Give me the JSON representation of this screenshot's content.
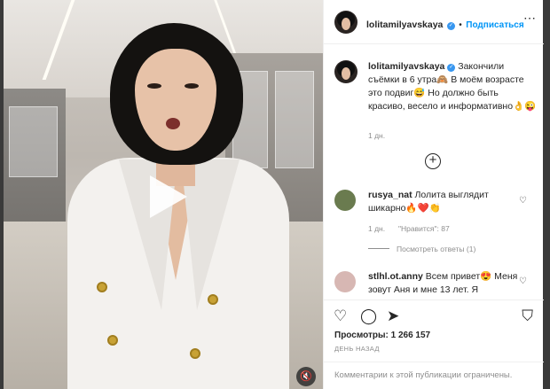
{
  "post": {
    "username": "lolitamilyavskaya",
    "verified_mark": "✓",
    "separator": "•",
    "follow_label": "Подписаться",
    "more_icon": "⋯",
    "caption": "Закончили съёмки в 6 утра🙈 В моём возрасте это подвиг😅 Но должно быть красиво, весело и информативно👌😜",
    "caption_age": "1 дн.",
    "load_more_icon": "+"
  },
  "comments": [
    {
      "username": "rusya_nat",
      "text": "Лолита выглядит шикарно🔥❤️👏",
      "age": "1 дн.",
      "likes": "\"Нравится\": 87",
      "replies": "Посмотреть ответы (1)"
    },
    {
      "username": "stlhl.ot.anny",
      "text": "Всем привет😍 Меня зовут Аня и мне 13 лет. Я"
    }
  ],
  "actions": {
    "like_icon": "♡",
    "comment_icon": "◯",
    "share_icon": "➤",
    "save_icon": "⛉",
    "likes_count": "Просмотры: 1 266 157",
    "time_ago": "ДЕНЬ НАЗАД"
  },
  "footer": {
    "limited_text": "Комментарии к этой публикации ограничены."
  },
  "video": {
    "play_icon": "▶",
    "mute_icon": "🔇"
  }
}
